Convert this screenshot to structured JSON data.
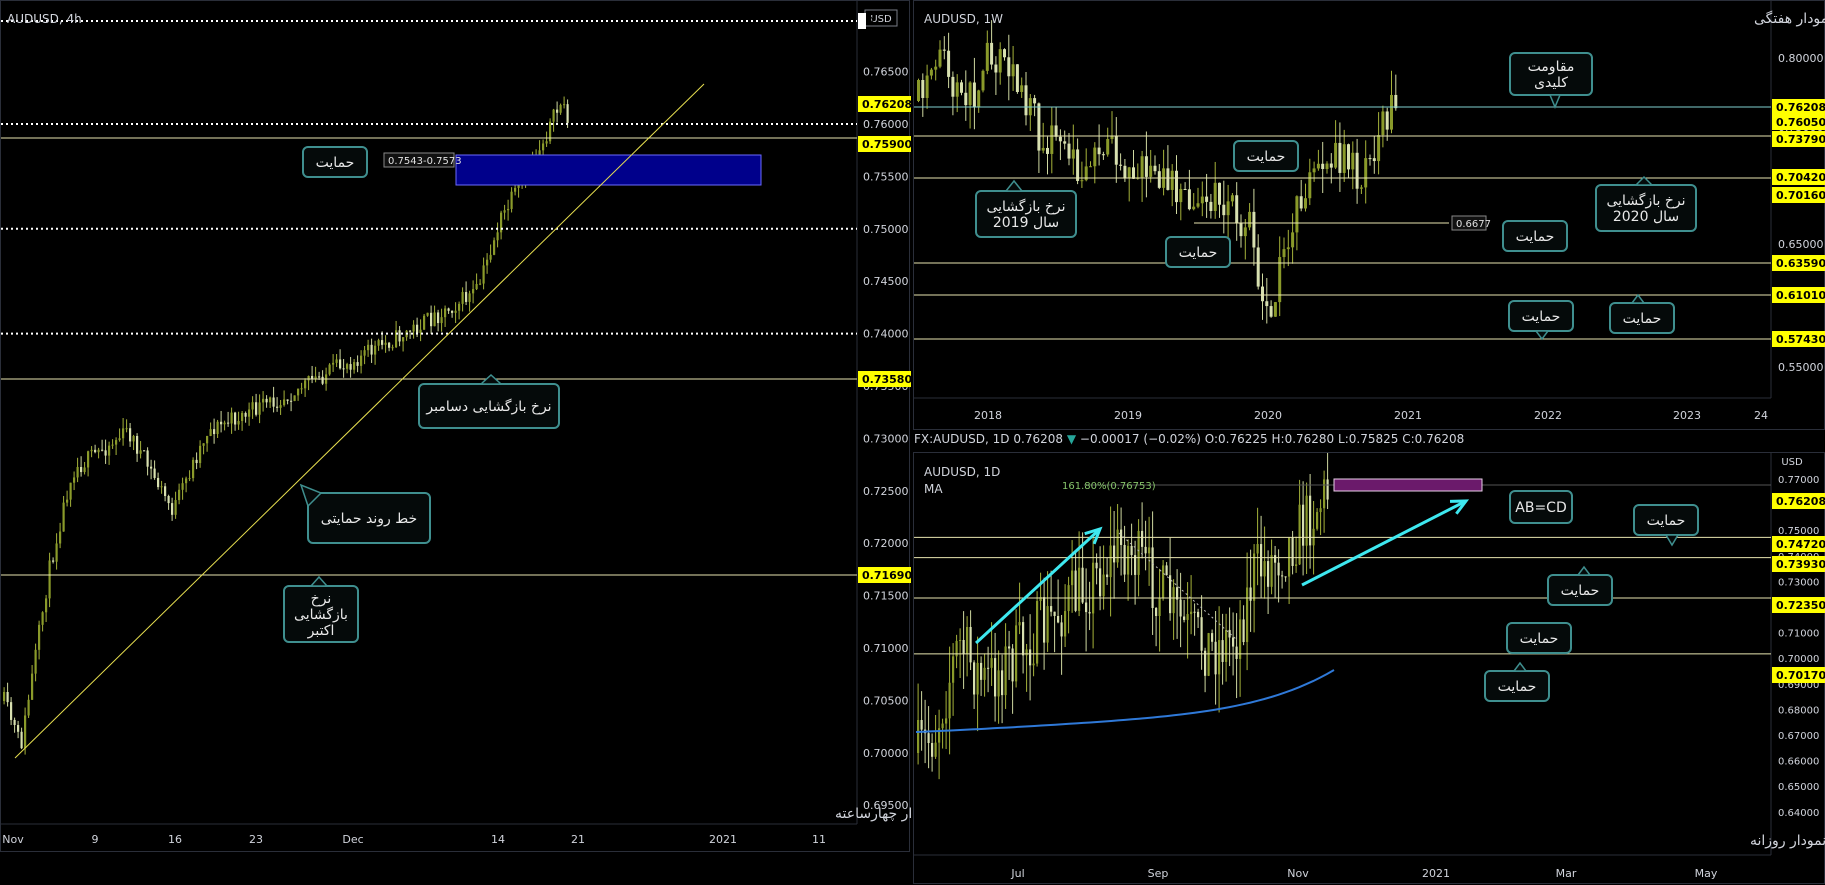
{
  "colors": {
    "background": "#000000",
    "grid": "#1e222d",
    "up": "#a5b23a",
    "down": "#cfd8a0",
    "hline": "#e8e5b0",
    "trend": "#e8e050",
    "dotted": "#ffffff",
    "badge": "#ffff00",
    "callout_border": "#3f8f8f",
    "zone": "#00008b",
    "cyan": "#3ee8f0",
    "ma": "#2f79d8",
    "purple": "#6b1a6b",
    "fib": "#86c46a"
  },
  "panels": {
    "h4": {
      "symbol": "AUDUSD, 4h",
      "currency_tag": "USD",
      "caption": "نمودار چهارساعته",
      "x_ticks": [
        "Nov",
        "9",
        "16",
        "23",
        "Dec",
        "14",
        "21",
        "2021",
        "11"
      ],
      "y_ticks": [
        "0.76500",
        "0.76000",
        "0.75500",
        "0.75000",
        "0.74500",
        "0.74000",
        "0.73500",
        "0.73000",
        "0.72500",
        "0.72000",
        "0.71500",
        "0.71000",
        "0.70500",
        "0.70000",
        "0.69500"
      ],
      "badges": [
        "0.76208",
        "0.75900",
        "0.73580",
        "0.71690"
      ],
      "zone_label": "0.7543-0.7573",
      "callouts": [
        "حمایت",
        "نرخ بازگشایی دسامبر",
        "خط روند حمایتی",
        "نرخ\nبازگشایی\nاکتبر"
      ]
    },
    "w1": {
      "symbol": "AUDUSD, 1W",
      "caption": "نمودار هفتگی",
      "x_ticks": [
        "2018",
        "2019",
        "2020",
        "2021",
        "2022",
        "2023",
        "24"
      ],
      "y_ticks": [
        "0.80000",
        "0.75000",
        "0.70000",
        "0.65000",
        "0.60000",
        "0.55000"
      ],
      "badges": [
        "0.76208",
        "0.76050",
        "0.73790",
        "0.70420",
        "0.70160",
        "0.63590",
        "0.61010",
        "0.57430"
      ],
      "level_label": "0.6677",
      "callouts": [
        "مقاومت\nکلیدی",
        "حمایت",
        "نرخ بازگشایی\nسال 2019",
        "حمایت",
        "نرخ بازگشایی\nسال 2020",
        "حمایت",
        "حمایت",
        "حمایت"
      ]
    },
    "d1": {
      "infobar": {
        "symbol": "FX:AUDUSD, 1D",
        "price": "0.76208",
        "arrow": "▼",
        "change": "−0.00017 (−0.02%)",
        "o_label": "O:",
        "o": "0.76225",
        "h_label": "H:",
        "h": "0.76280",
        "l_label": "L:",
        "l": "0.75825",
        "c_label": "C:",
        "c": "0.76208"
      },
      "symbol": "AUDUSD, 1D",
      "indicator": "MA",
      "currency_tag": "USD",
      "caption": "نمودار روزانه",
      "fib_label": "161.80%(0.76753)",
      "pattern_label": "AB=CD",
      "x_ticks": [
        "Jul",
        "Sep",
        "Nov",
        "2021",
        "Mar",
        "May"
      ],
      "y_ticks": [
        "0.77000",
        "0.76000",
        "0.75000",
        "0.74000",
        "0.73000",
        "0.72000",
        "0.71000",
        "0.70000",
        "0.69000",
        "0.68000",
        "0.67000",
        "0.66000",
        "0.65000",
        "0.64000"
      ],
      "badges": [
        "0.76208",
        "0.74720",
        "0.73930",
        "0.72350",
        "0.70170"
      ],
      "callouts": [
        "حمایت",
        "حمایت",
        "حمایت",
        "حمایت"
      ]
    }
  }
}
